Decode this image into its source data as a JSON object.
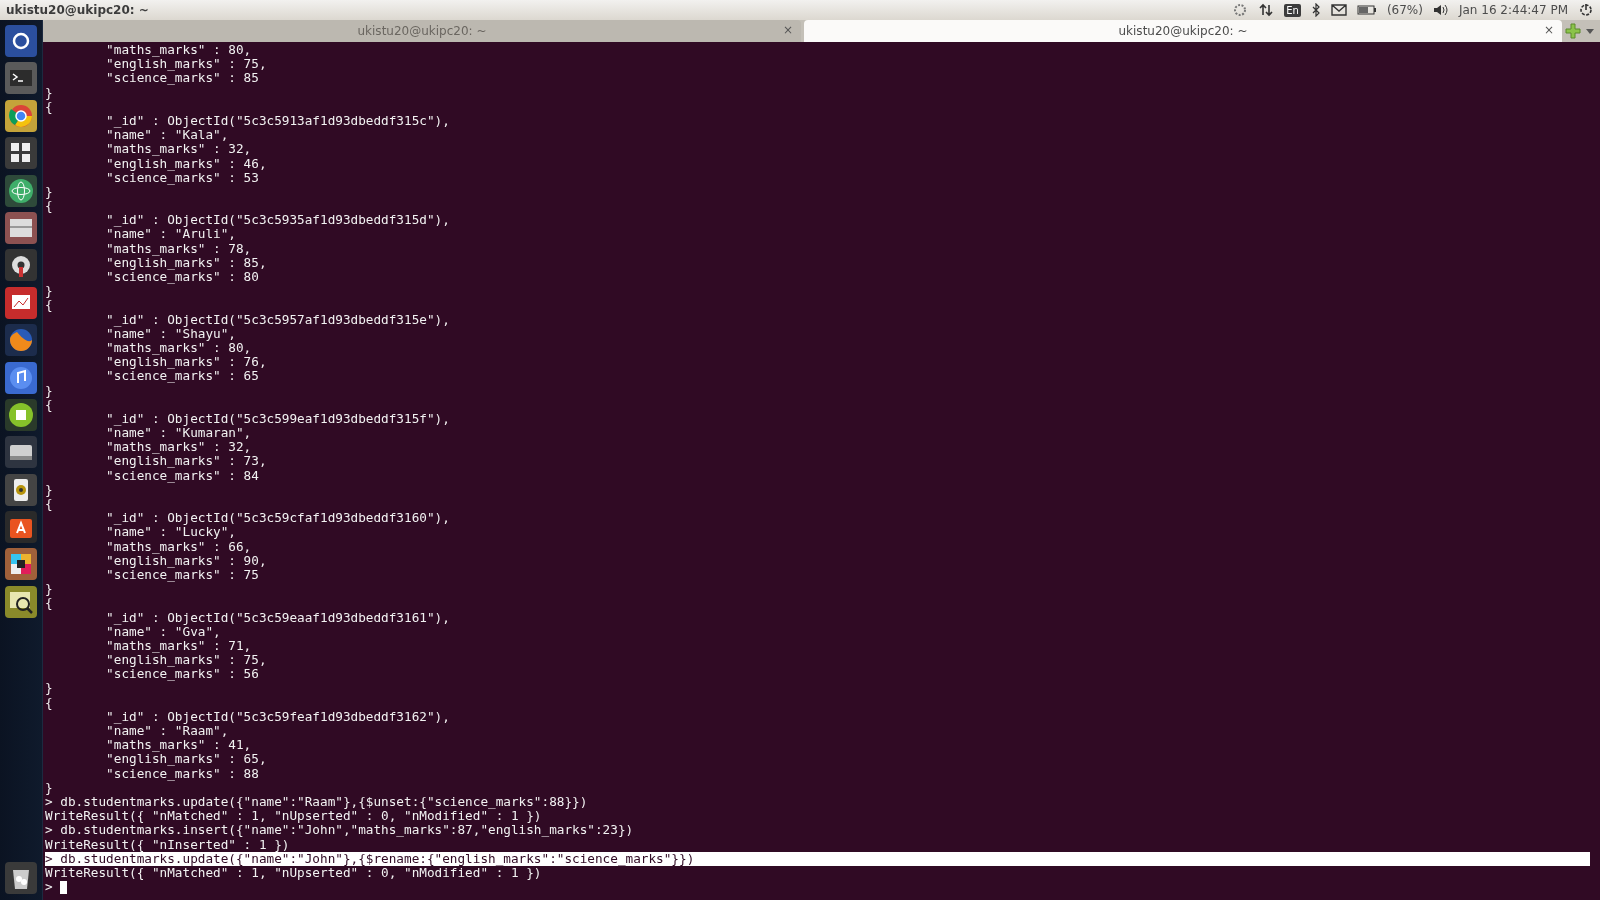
{
  "top_bar": {
    "title": "ukistu20@ukipc20: ~",
    "keyboard_layout": "En",
    "battery": "(67%)",
    "clock": "Jan 16 2:44:47 PM"
  },
  "tabs": [
    {
      "title": "ukistu20@ukipc20: ~",
      "close": "×",
      "selected": false
    },
    {
      "title": "ukistu20@ukipc20: ~",
      "close": "×",
      "selected": true
    }
  ],
  "terminal": {
    "lines": [
      {
        "kind": "output",
        "text": "\t\"maths_marks\" : 80,",
        "highlighted": false
      },
      {
        "kind": "output",
        "text": "\t\"english_marks\" : 75,",
        "highlighted": false
      },
      {
        "kind": "output",
        "text": "\t\"science_marks\" : 85",
        "highlighted": false
      },
      {
        "kind": "output",
        "text": "}",
        "highlighted": false
      },
      {
        "kind": "output",
        "text": "{",
        "highlighted": false
      },
      {
        "kind": "output",
        "text": "\t\"_id\" : ObjectId(\"5c3c5913af1d93dbeddf315c\"),",
        "highlighted": false
      },
      {
        "kind": "output",
        "text": "\t\"name\" : \"Kala\",",
        "highlighted": false
      },
      {
        "kind": "output",
        "text": "\t\"maths_marks\" : 32,",
        "highlighted": false
      },
      {
        "kind": "output",
        "text": "\t\"english_marks\" : 46,",
        "highlighted": false
      },
      {
        "kind": "output",
        "text": "\t\"science_marks\" : 53",
        "highlighted": false
      },
      {
        "kind": "output",
        "text": "}",
        "highlighted": false
      },
      {
        "kind": "output",
        "text": "{",
        "highlighted": false
      },
      {
        "kind": "output",
        "text": "\t\"_id\" : ObjectId(\"5c3c5935af1d93dbeddf315d\"),",
        "highlighted": false
      },
      {
        "kind": "output",
        "text": "\t\"name\" : \"Aruli\",",
        "highlighted": false
      },
      {
        "kind": "output",
        "text": "\t\"maths_marks\" : 78,",
        "highlighted": false
      },
      {
        "kind": "output",
        "text": "\t\"english_marks\" : 85,",
        "highlighted": false
      },
      {
        "kind": "output",
        "text": "\t\"science_marks\" : 80",
        "highlighted": false
      },
      {
        "kind": "output",
        "text": "}",
        "highlighted": false
      },
      {
        "kind": "output",
        "text": "{",
        "highlighted": false
      },
      {
        "kind": "output",
        "text": "\t\"_id\" : ObjectId(\"5c3c5957af1d93dbeddf315e\"),",
        "highlighted": false
      },
      {
        "kind": "output",
        "text": "\t\"name\" : \"Shayu\",",
        "highlighted": false
      },
      {
        "kind": "output",
        "text": "\t\"maths_marks\" : 80,",
        "highlighted": false
      },
      {
        "kind": "output",
        "text": "\t\"english_marks\" : 76,",
        "highlighted": false
      },
      {
        "kind": "output",
        "text": "\t\"science_marks\" : 65",
        "highlighted": false
      },
      {
        "kind": "output",
        "text": "}",
        "highlighted": false
      },
      {
        "kind": "output",
        "text": "{",
        "highlighted": false
      },
      {
        "kind": "output",
        "text": "\t\"_id\" : ObjectId(\"5c3c599eaf1d93dbeddf315f\"),",
        "highlighted": false
      },
      {
        "kind": "output",
        "text": "\t\"name\" : \"Kumaran\",",
        "highlighted": false
      },
      {
        "kind": "output",
        "text": "\t\"maths_marks\" : 32,",
        "highlighted": false
      },
      {
        "kind": "output",
        "text": "\t\"english_marks\" : 73,",
        "highlighted": false
      },
      {
        "kind": "output",
        "text": "\t\"science_marks\" : 84",
        "highlighted": false
      },
      {
        "kind": "output",
        "text": "}",
        "highlighted": false
      },
      {
        "kind": "output",
        "text": "{",
        "highlighted": false
      },
      {
        "kind": "output",
        "text": "\t\"_id\" : ObjectId(\"5c3c59cfaf1d93dbeddf3160\"),",
        "highlighted": false
      },
      {
        "kind": "output",
        "text": "\t\"name\" : \"Lucky\",",
        "highlighted": false
      },
      {
        "kind": "output",
        "text": "\t\"maths_marks\" : 66,",
        "highlighted": false
      },
      {
        "kind": "output",
        "text": "\t\"english_marks\" : 90,",
        "highlighted": false
      },
      {
        "kind": "output",
        "text": "\t\"science_marks\" : 75",
        "highlighted": false
      },
      {
        "kind": "output",
        "text": "}",
        "highlighted": false
      },
      {
        "kind": "output",
        "text": "{",
        "highlighted": false
      },
      {
        "kind": "output",
        "text": "\t\"_id\" : ObjectId(\"5c3c59eaaf1d93dbeddf3161\"),",
        "highlighted": false
      },
      {
        "kind": "output",
        "text": "\t\"name\" : \"Gva\",",
        "highlighted": false
      },
      {
        "kind": "output",
        "text": "\t\"maths_marks\" : 71,",
        "highlighted": false
      },
      {
        "kind": "output",
        "text": "\t\"english_marks\" : 75,",
        "highlighted": false
      },
      {
        "kind": "output",
        "text": "\t\"science_marks\" : 56",
        "highlighted": false
      },
      {
        "kind": "output",
        "text": "}",
        "highlighted": false
      },
      {
        "kind": "output",
        "text": "{",
        "highlighted": false
      },
      {
        "kind": "output",
        "text": "\t\"_id\" : ObjectId(\"5c3c59feaf1d93dbeddf3162\"),",
        "highlighted": false
      },
      {
        "kind": "output",
        "text": "\t\"name\" : \"Raam\",",
        "highlighted": false
      },
      {
        "kind": "output",
        "text": "\t\"maths_marks\" : 41,",
        "highlighted": false
      },
      {
        "kind": "output",
        "text": "\t\"english_marks\" : 65,",
        "highlighted": false
      },
      {
        "kind": "output",
        "text": "\t\"science_marks\" : 88",
        "highlighted": false
      },
      {
        "kind": "output",
        "text": "}",
        "highlighted": false
      },
      {
        "kind": "command",
        "text": "> db.studentmarks.update({\"name\":\"Raam\"},{$unset:{\"science_marks\":88}})",
        "highlighted": false
      },
      {
        "kind": "output",
        "text": "WriteResult({ \"nMatched\" : 1, \"nUpserted\" : 0, \"nModified\" : 1 })",
        "highlighted": false
      },
      {
        "kind": "command",
        "text": "> db.studentmarks.insert({\"name\":\"John\",\"maths_marks\":87,\"english_marks\":23})",
        "highlighted": false
      },
      {
        "kind": "output",
        "text": "WriteResult({ \"nInserted\" : 1 })",
        "highlighted": false
      },
      {
        "kind": "command",
        "text": "> db.studentmarks.update({\"name\":\"John\"},{$rename:{\"english_marks\":\"science_marks\"}})",
        "highlighted": true
      },
      {
        "kind": "output",
        "text": "WriteResult({ \"nMatched\" : 1, \"nUpserted\" : 0, \"nModified\" : 1 })",
        "highlighted": false
      },
      {
        "kind": "prompt",
        "text": ">",
        "highlighted": false
      }
    ]
  }
}
